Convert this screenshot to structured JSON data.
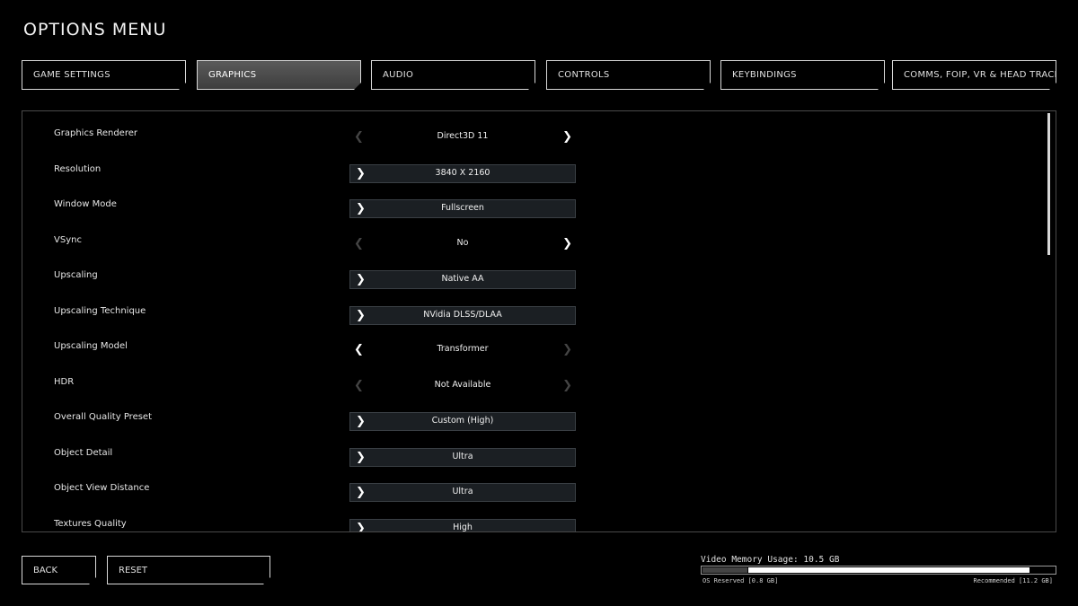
{
  "title": "OPTIONS MENU",
  "tabs": [
    {
      "label": "GAME SETTINGS"
    },
    {
      "label": "GRAPHICS"
    },
    {
      "label": "AUDIO"
    },
    {
      "label": "CONTROLS"
    },
    {
      "label": "KEYBINDINGS"
    },
    {
      "label": "COMMS, FOIP, VR & HEAD TRACKING"
    }
  ],
  "active_tab": "GRAPHICS",
  "settings": [
    {
      "label": "Graphics Renderer",
      "value": "Direct3D 11",
      "control": "selector",
      "left_enabled": false,
      "right_enabled": true
    },
    {
      "label": "Resolution",
      "value": "3840 X 2160",
      "control": "dropdown"
    },
    {
      "label": "Window Mode",
      "value": "Fullscreen",
      "control": "dropdown"
    },
    {
      "label": "VSync",
      "value": "No",
      "control": "selector",
      "left_enabled": false,
      "right_enabled": true
    },
    {
      "label": "Upscaling",
      "value": "Native AA",
      "control": "dropdown"
    },
    {
      "label": "Upscaling Technique",
      "value": "NVidia DLSS/DLAA",
      "control": "dropdown"
    },
    {
      "label": "Upscaling Model",
      "value": "Transformer",
      "control": "selector",
      "left_enabled": true,
      "right_enabled": false
    },
    {
      "label": "HDR",
      "value": "Not Available",
      "control": "selector",
      "left_enabled": false,
      "right_enabled": false
    },
    {
      "label": "Overall Quality Preset",
      "value": "Custom (High)",
      "control": "dropdown"
    },
    {
      "label": "Object Detail",
      "value": "Ultra",
      "control": "dropdown"
    },
    {
      "label": "Object View Distance",
      "value": "Ultra",
      "control": "dropdown"
    },
    {
      "label": "Textures Quality",
      "value": "High",
      "control": "dropdown"
    }
  ],
  "footer": {
    "back_label": "BACK",
    "reset_label": "RESET"
  },
  "memory": {
    "label": "Video Memory Usage: 10.5 GB",
    "os_reserved_label": "OS Reserved [0.8 GB]",
    "recommended_label": "Recommended [11.2 GB]",
    "capacity_gb": 12,
    "os_reserved_gb": 0.8,
    "used_gb": 10.5,
    "recommended_gb": 11.2
  },
  "icons": {
    "arrow_left": "chevron-left-icon",
    "arrow_right": "chevron-right-icon"
  }
}
